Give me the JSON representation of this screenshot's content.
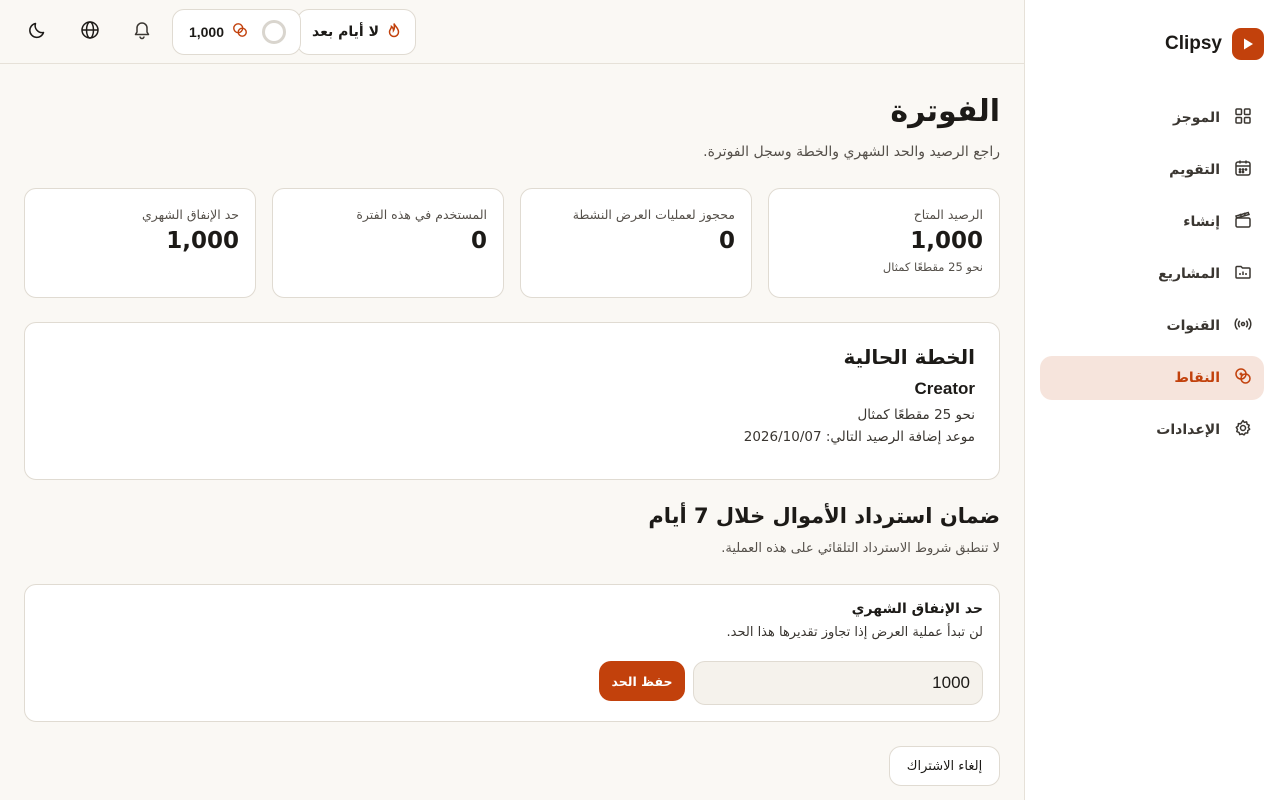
{
  "app": {
    "name": "Clipsy"
  },
  "sidebar": {
    "items": [
      {
        "label": "الموجز",
        "icon": "grid-icon"
      },
      {
        "label": "التقويم",
        "icon": "calendar-icon"
      },
      {
        "label": "إنشاء",
        "icon": "clapperboard-icon"
      },
      {
        "label": "المشاريع",
        "icon": "folder-icon"
      },
      {
        "label": "القنوات",
        "icon": "broadcast-icon"
      },
      {
        "label": "النقاط",
        "icon": "coins-icon",
        "active": true
      },
      {
        "label": "الإعدادات",
        "icon": "gear-icon"
      }
    ]
  },
  "header": {
    "streak_label": "لا أيام بعد",
    "credits": "1,000"
  },
  "page": {
    "title": "الفوترة",
    "subtitle": "راجع الرصيد والحد الشهري والخطة وسجل الفوترة."
  },
  "stats": [
    {
      "label": "الرصيد المتاح",
      "value": "1,000",
      "note": "نحو 25 مقطعًا كمثال"
    },
    {
      "label": "محجوز لعمليات العرض النشطة",
      "value": "0"
    },
    {
      "label": "المستخدم في هذه الفترة",
      "value": "0"
    },
    {
      "label": "حد الإنفاق الشهري",
      "value": "1,000"
    }
  ],
  "plan": {
    "title": "الخطة الحالية",
    "name": "Creator",
    "example": "نحو 25 مقطعًا كمثال",
    "next_topup": "موعد إضافة الرصيد التالي: 2026/10/07"
  },
  "refund": {
    "title": "ضمان استرداد الأموال خلال 7 أيام",
    "subtitle": "لا تنطبق شروط الاسترداد التلقائي على هذه العملية."
  },
  "limit": {
    "title": "حد الإنفاق الشهري",
    "description": "لن تبدأ عملية العرض إذا تجاوز تقديرها هذا الحد.",
    "value": "1000",
    "save_label": "حفظ الحد"
  },
  "cancel_label": "إلغاء الاشتراك",
  "colors": {
    "accent": "#c2410c",
    "active_bg": "#f6e4dc"
  }
}
